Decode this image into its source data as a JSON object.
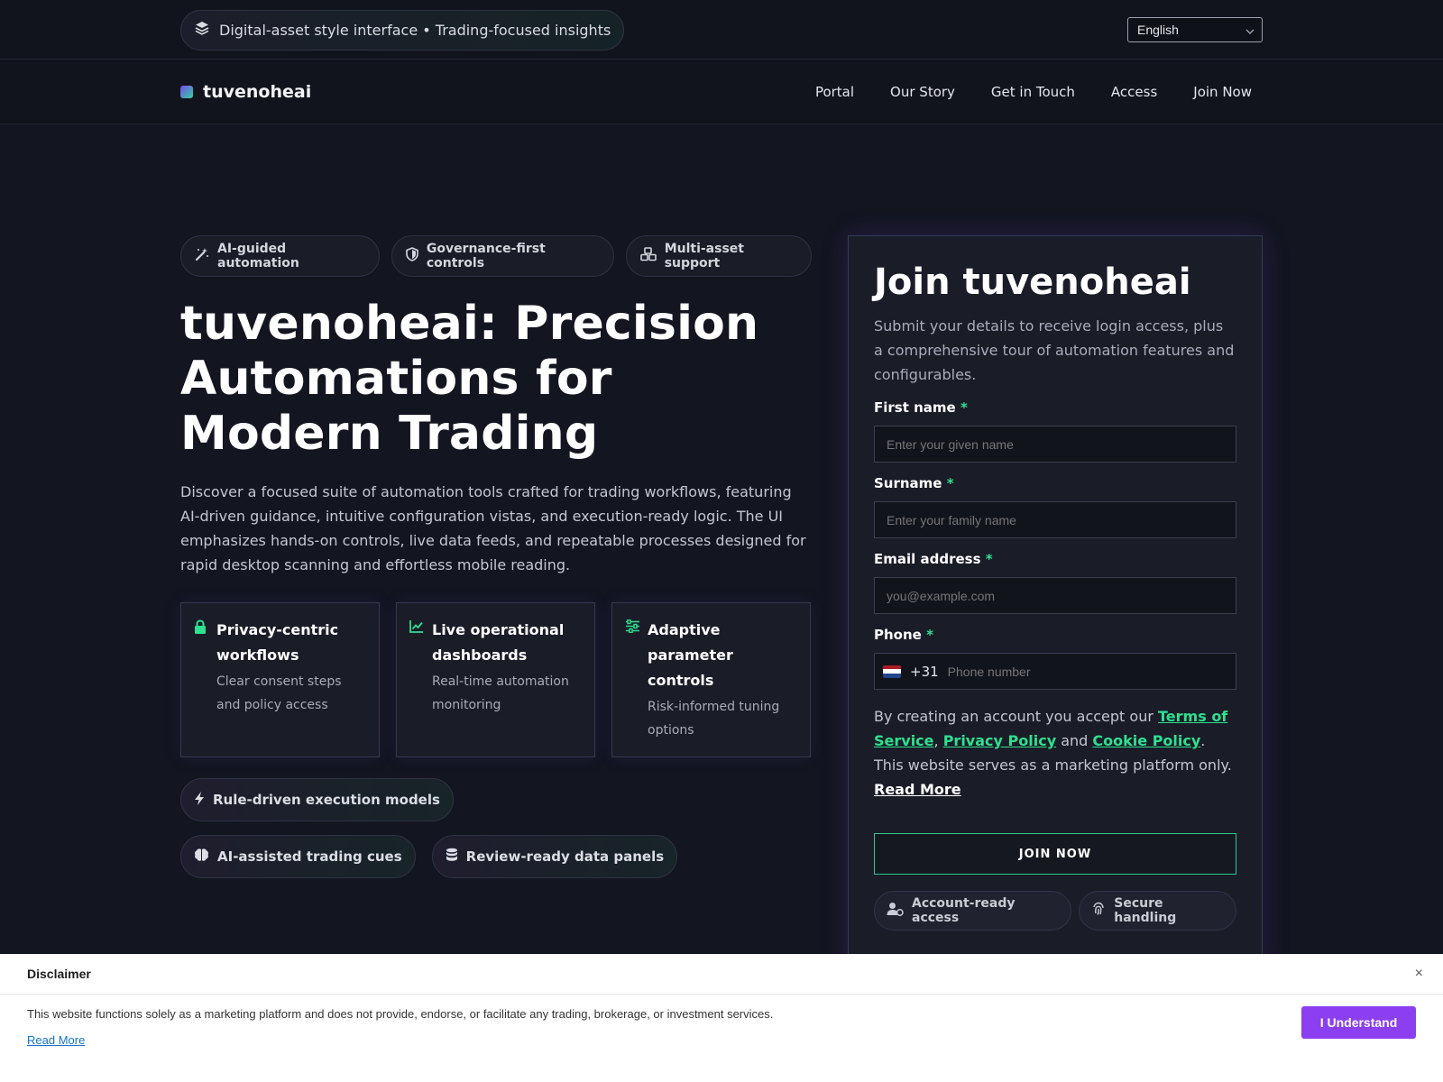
{
  "topbar": {
    "tagline": "Digital-asset style interface • Trading-focused insights",
    "language": "English"
  },
  "nav": {
    "brand": "tuvenoheai",
    "links": [
      "Portal",
      "Our Story",
      "Get in Touch",
      "Access",
      "Join Now"
    ]
  },
  "hero": {
    "chips": [
      "AI-guided automation",
      "Governance-first controls",
      "Multi-asset support"
    ],
    "title": "tuvenoheai: Precision Automations for Modern Trading",
    "lead": "Discover a focused suite of automation tools crafted for trading workflows, featuring AI-driven guidance, intuitive configuration vistas, and execution-ready logic. The UI emphasizes hands-on controls, live data feeds, and repeatable processes designed for rapid desktop scanning and effortless mobile reading.",
    "cards": [
      {
        "title": "Privacy-centric workflows",
        "text": "Clear consent steps and policy access"
      },
      {
        "title": "Live operational dashboards",
        "text": "Real-time automation monitoring"
      },
      {
        "title": "Adaptive parameter controls",
        "text": "Risk-informed tuning options"
      }
    ],
    "tags": [
      "Rule-driven execution models",
      "AI-assisted trading cues",
      "Review-ready data panels"
    ]
  },
  "form": {
    "title": "Join tuvenoheai",
    "subtitle": "Submit your details to receive login access, plus a comprehensive tour of automation features and configurables.",
    "first_name_label": "First name",
    "first_name_placeholder": "Enter your given name",
    "surname_label": "Surname",
    "surname_placeholder": "Enter your family name",
    "email_label": "Email address",
    "email_placeholder": "you@example.com",
    "phone_label": "Phone",
    "dial_code": "+31",
    "phone_placeholder": "Phone number",
    "required_mark": "*",
    "legal_prefix": "By creating an account you accept our",
    "terms": "Terms of Service",
    "sep1": ",",
    "privacy": "Privacy Policy",
    "and": "and",
    "cookie": "Cookie Policy",
    "legal_suffix": ". This website serves as a marketing platform only.",
    "read_more": "Read More",
    "submit": "JOIN NOW",
    "badges": [
      "Account-ready access",
      "Secure handling"
    ]
  },
  "disclaimer": {
    "title": "Disclaimer",
    "close": "×",
    "text": "This website functions solely as a marketing platform and does not provide, endorse, or facilitate any trading, brokerage, or investment services.",
    "read_more": "Read More",
    "button": "I Understand"
  },
  "colors": {
    "accent_green": "#2ee08f",
    "accent_purple": "#8b3ff0",
    "background": "#131520"
  },
  "icons": {
    "tagline": "layers-icon",
    "chips": [
      "magic-wand-icon",
      "shield-icon",
      "cubes-icon"
    ],
    "cards": [
      "lock-icon",
      "line-chart-icon",
      "sliders-icon"
    ],
    "tags": [
      "bolt-icon",
      "brain-icon",
      "database-icon"
    ],
    "badges": [
      "user-check-icon",
      "fingerprint-icon"
    ]
  }
}
